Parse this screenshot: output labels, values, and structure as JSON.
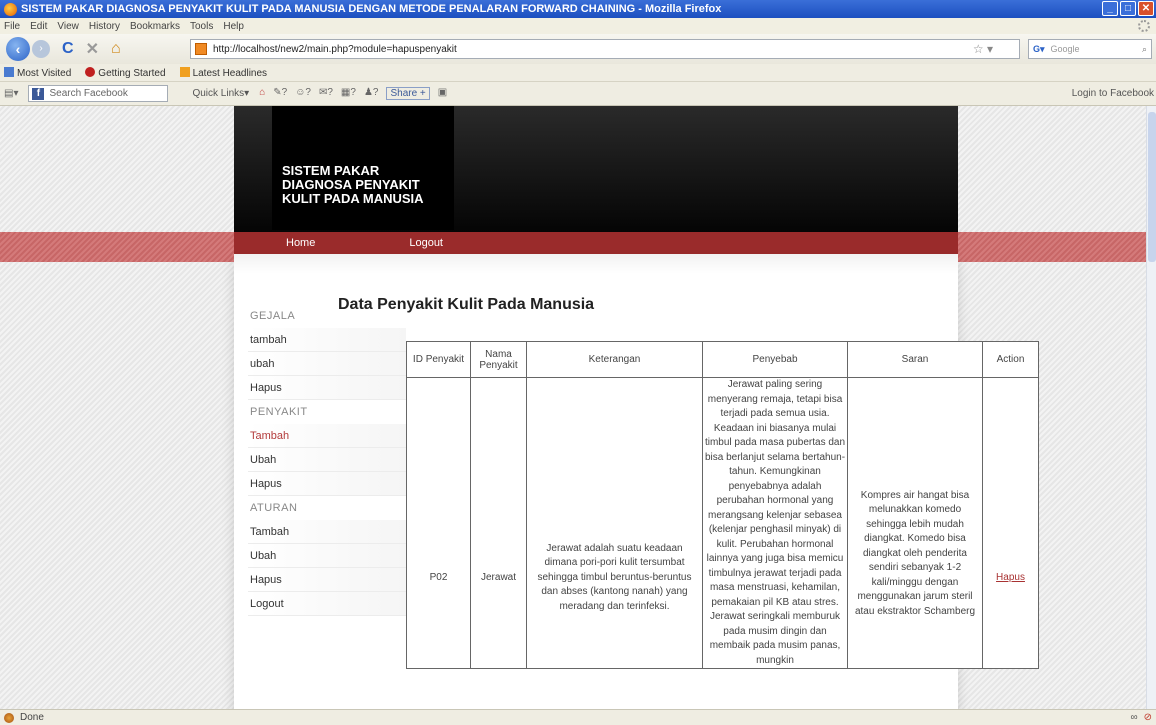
{
  "window": {
    "title": "SISTEM PAKAR DIAGNOSA PENYAKIT KULIT PADA MANUSIA DENGAN METODE PENALARAN FORWARD CHAINING - Mozilla Firefox"
  },
  "menu": [
    "File",
    "Edit",
    "View",
    "History",
    "Bookmarks",
    "Tools",
    "Help"
  ],
  "nav": {
    "url": "http://localhost/new2/main.php?module=hapuspenyakit",
    "search_placeholder": "Google"
  },
  "bookmarks": [
    "Most Visited",
    "Getting Started",
    "Latest Headlines"
  ],
  "fb_toolbar": {
    "search_placeholder": "Search Facebook",
    "quick_links": "Quick Links",
    "share": "Share",
    "login": "Login to Facebook"
  },
  "site": {
    "logo_lines": [
      "SISTEM PAKAR",
      "DIAGNOSA PENYAKIT",
      "KULIT PADA MANUSIA"
    ],
    "nav": [
      "Home",
      "Logout"
    ]
  },
  "sidebar": {
    "sections": [
      {
        "title": "GEJALA",
        "items": [
          "tambah",
          "ubah",
          "Hapus"
        ]
      },
      {
        "title": "PENYAKIT",
        "items": [
          "Tambah",
          "Ubah",
          "Hapus"
        ]
      },
      {
        "title": "ATURAN",
        "items": [
          "Tambah",
          "Ubah",
          "Hapus",
          "Logout"
        ]
      }
    ]
  },
  "main": {
    "title": "Data Penyakit Kulit Pada Manusia",
    "columns": [
      "ID Penyakit",
      "Nama Penyakit",
      "Keterangan",
      "Penyebab",
      "Saran",
      "Action"
    ],
    "row": {
      "id": "P02",
      "nama": "Jerawat",
      "keterangan": "Jerawat adalah suatu keadaan dimana pori-pori kulit tersumbat sehingga timbul beruntus-beruntus dan abses (kantong nanah) yang meradang dan terinfeksi.",
      "penyebab": "Jerawat paling sering menyerang remaja, tetapi bisa terjadi pada semua usia. Keadaan ini biasanya mulai timbul pada masa pubertas dan bisa berlanjut selama bertahun-tahun. Kemungkinan penyebabnya adalah perubahan hormonal yang merangsang kelenjar sebasea (kelenjar penghasil minyak) di kulit. Perubahan hormonal lainnya yang juga bisa memicu timbulnya jerawat terjadi pada masa menstruasi, kehamilan, pemakaian pil KB atau stres. Jerawat seringkali memburuk pada musim dingin dan membaik pada musim panas, mungkin",
      "saran": "Kompres air hangat bisa melunakkan komedo sehingga lebih mudah diangkat. Komedo bisa diangkat oleh penderita sendiri sebanyak 1-2 kali/minggu dengan menggunakan jarum steril atau ekstraktor Schamberg",
      "action": "Hapus"
    }
  },
  "status": "Done"
}
